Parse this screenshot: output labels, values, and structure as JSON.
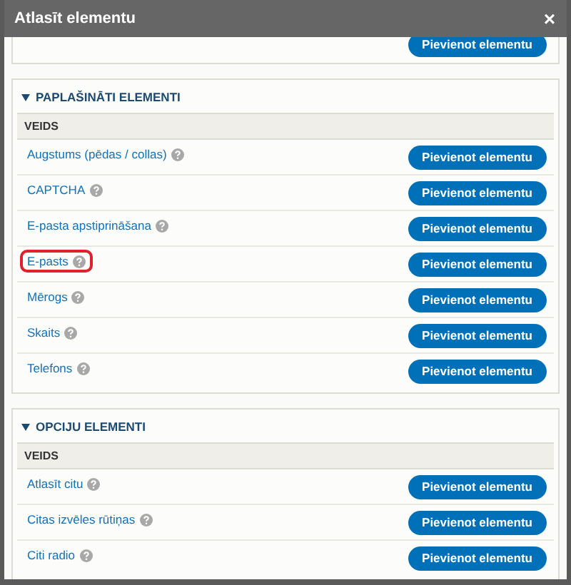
{
  "window": {
    "title": "Atlasīt elementu",
    "close": "×"
  },
  "top_section": {
    "button": "Pievienot elementu"
  },
  "sections": [
    {
      "title": "PAPLAŠINĀTI ELEMENTI",
      "expanded": true,
      "column": "VEIDS",
      "rows": [
        {
          "label": "Augstums (pēdas / collas)",
          "button": "Pievienot elementu",
          "highlighted": false
        },
        {
          "label": "CAPTCHA",
          "button": "Pievienot elementu",
          "highlighted": false
        },
        {
          "label": "E-pasta apstiprināšana",
          "button": "Pievienot elementu",
          "highlighted": false
        },
        {
          "label": "E-pasts",
          "button": "Pievienot elementu",
          "highlighted": true
        },
        {
          "label": "Mērogs",
          "button": "Pievienot elementu",
          "highlighted": false
        },
        {
          "label": "Skaits",
          "button": "Pievienot elementu",
          "highlighted": false
        },
        {
          "label": "Telefons",
          "button": "Pievienot elementu",
          "highlighted": false
        }
      ]
    },
    {
      "title": "OPCIJU ELEMENTI",
      "expanded": true,
      "column": "VEIDS",
      "rows": [
        {
          "label": "Atlasīt citu",
          "button": "Pievienot elementu",
          "highlighted": false
        },
        {
          "label": "Citas izvēles rūtiņas",
          "button": "Pievienot elementu",
          "highlighted": false
        },
        {
          "label": "Citi radio",
          "button": "Pievienot elementu",
          "highlighted": false
        }
      ]
    }
  ]
}
